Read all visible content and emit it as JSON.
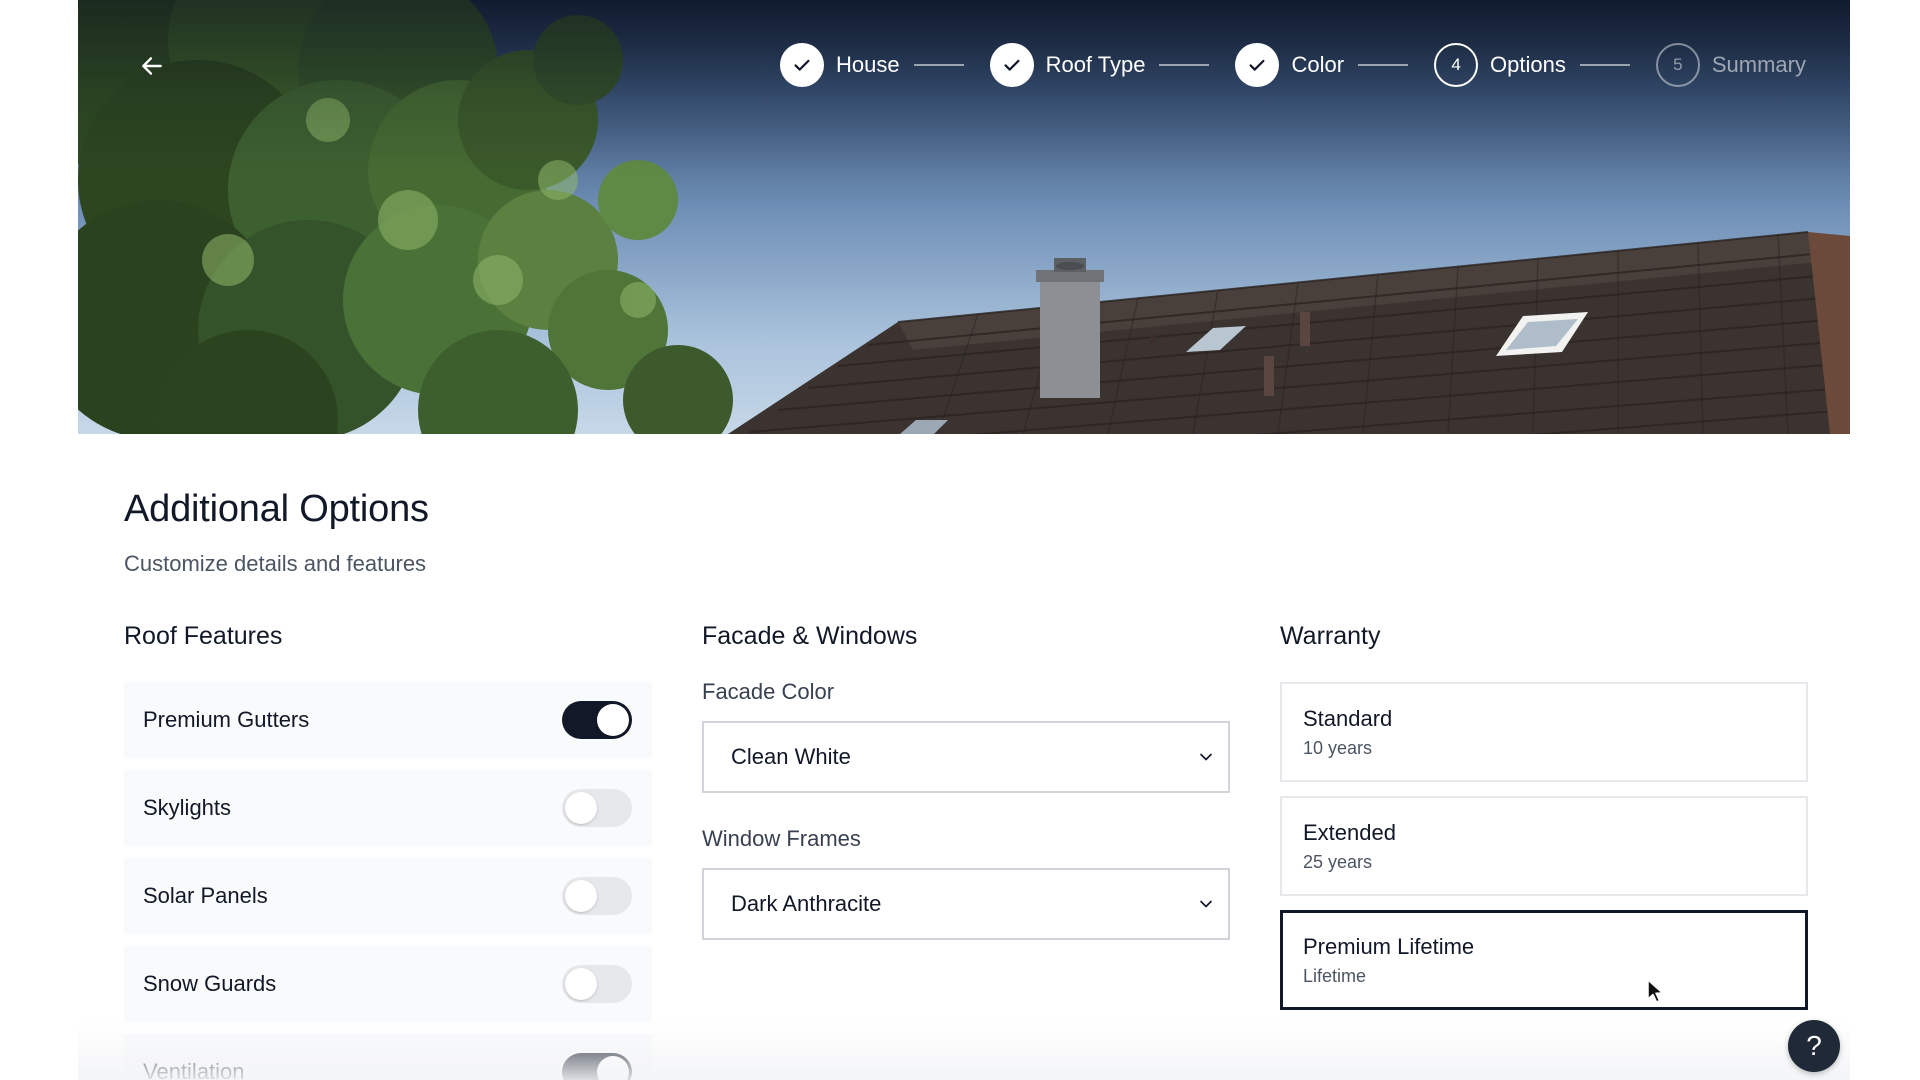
{
  "header": {
    "back_icon": "arrow-left-icon",
    "steps": [
      {
        "number": "1",
        "label": "House",
        "status": "done"
      },
      {
        "number": "2",
        "label": "Roof Type",
        "status": "done"
      },
      {
        "number": "3",
        "label": "Color",
        "status": "done"
      },
      {
        "number": "4",
        "label": "Options",
        "status": "current"
      },
      {
        "number": "5",
        "label": "Summary",
        "status": "upcoming"
      }
    ]
  },
  "page": {
    "title": "Additional Options",
    "subtitle": "Customize details and features"
  },
  "roof_features": {
    "title": "Roof Features",
    "items": [
      {
        "label": "Premium Gutters",
        "enabled": true
      },
      {
        "label": "Skylights",
        "enabled": false
      },
      {
        "label": "Solar Panels",
        "enabled": false
      },
      {
        "label": "Snow Guards",
        "enabled": false
      },
      {
        "label": "Ventilation",
        "enabled": true
      }
    ]
  },
  "facade": {
    "title": "Facade & Windows",
    "facade_color_label": "Facade Color",
    "facade_color_value": "Clean White",
    "window_frames_label": "Window Frames",
    "window_frames_value": "Dark Anthracite"
  },
  "warranty": {
    "title": "Warranty",
    "options": [
      {
        "name": "Standard",
        "term": "10 years",
        "selected": false
      },
      {
        "name": "Extended",
        "term": "25 years",
        "selected": false
      },
      {
        "name": "Premium Lifetime",
        "term": "Lifetime",
        "selected": true
      }
    ]
  },
  "help": {
    "icon": "question-mark-icon",
    "label": "?"
  },
  "colors": {
    "accent": "#111827",
    "toggle_off": "#e5e7eb",
    "card_border": "#e5e7eb"
  }
}
